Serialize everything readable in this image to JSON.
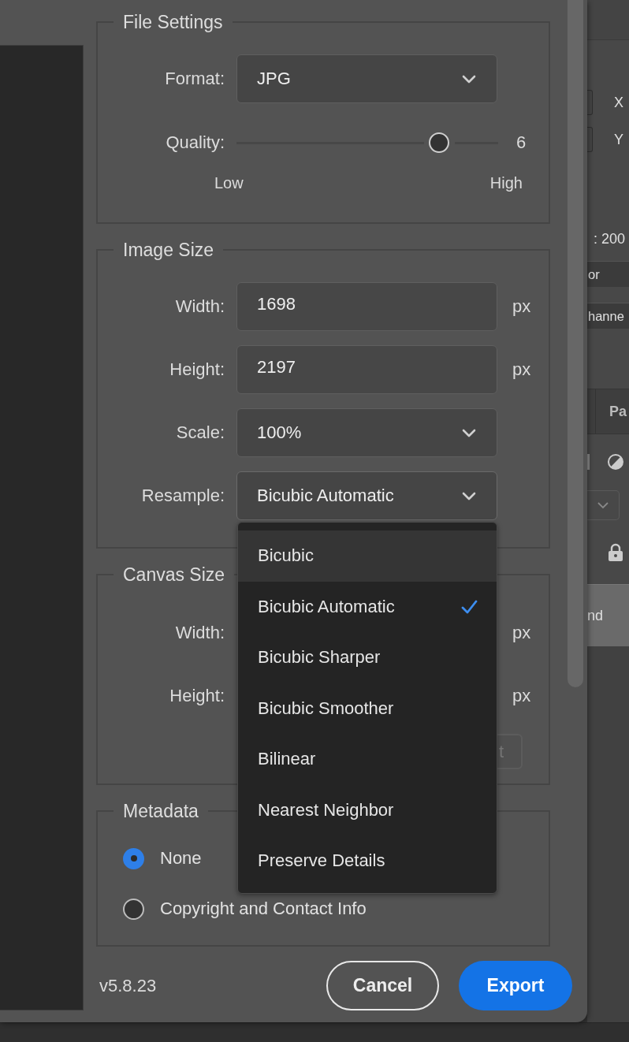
{
  "dialog": {
    "sections": [
      {
        "title": "File Settings",
        "rows": [
          {
            "kind": "select",
            "label": "Format:",
            "value": "JPG"
          },
          {
            "kind": "slider",
            "label": "Quality:",
            "level": 0.8,
            "reading": "6",
            "min_label": "Low",
            "max_label": "High"
          }
        ]
      },
      {
        "title": "Image Size",
        "rows": [
          {
            "kind": "input",
            "label": "Width:",
            "value": "1698",
            "unit": "px"
          },
          {
            "kind": "input",
            "label": "Height:",
            "value": "2197",
            "unit": "px"
          },
          {
            "kind": "select",
            "label": "Scale:",
            "value": "100%"
          },
          {
            "kind": "select",
            "label": "Resample:",
            "value": "Bicubic Automatic",
            "expanded": true,
            "options": [
              {
                "label": "Bicubic",
                "selected": false,
                "highlighted": true
              },
              {
                "label": "Bicubic Automatic",
                "selected": true,
                "highlighted": false
              },
              {
                "label": "Bicubic Sharper",
                "selected": false,
                "highlighted": false
              },
              {
                "label": "Bicubic Smoother",
                "selected": false,
                "highlighted": false
              },
              {
                "label": "Bilinear",
                "selected": false,
                "highlighted": false
              },
              {
                "label": "Nearest Neighbor",
                "selected": false,
                "highlighted": false
              },
              {
                "label": "Preserve Details",
                "selected": false,
                "highlighted": false
              }
            ]
          }
        ]
      },
      {
        "title": "Canvas Size",
        "rows": [
          {
            "kind": "covered",
            "label": "Width:",
            "unit": "px"
          },
          {
            "kind": "covered",
            "label": "Height:",
            "unit": "px"
          },
          {
            "kind": "button",
            "label": "t",
            "disabled": true
          }
        ]
      },
      {
        "title": "Metadata",
        "rows": [
          {
            "kind": "radio",
            "label": "None",
            "selected": true
          },
          {
            "kind": "radio",
            "label": "Copyright and Contact Info",
            "selected": false
          }
        ]
      }
    ],
    "version": "v5.8.23",
    "buttons": [
      {
        "kind": "secondary",
        "label": "Cancel"
      },
      {
        "kind": "primary",
        "label": "Export"
      }
    ]
  },
  "side_panel": {
    "coordinates": [
      {
        "label": "X"
      },
      {
        "label": "Y"
      }
    ],
    "info": ": 200",
    "rows": [
      "or",
      "hanne"
    ],
    "tab": "Pa",
    "layer": "nd"
  }
}
